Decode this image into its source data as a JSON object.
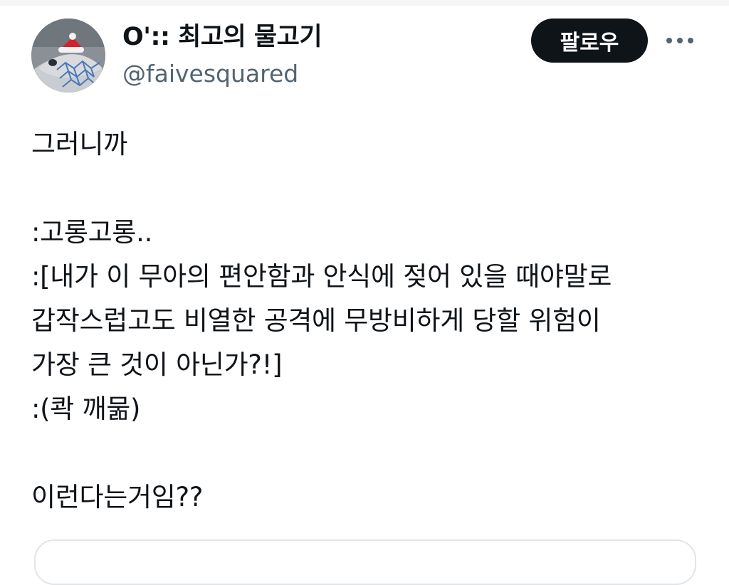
{
  "author": {
    "display_name": "O':: 최고의 물고기",
    "handle": "@faivesquared",
    "avatar_icon": "fish-with-santa-hat-avatar"
  },
  "actions": {
    "follow_label": "팔로우",
    "more_icon": "more-horizontal-icon"
  },
  "tweet": {
    "lines": [
      "그러니까",
      "",
      ":고롱고롱..",
      ":[내가 이 무아의 편안함과 안식에 젖어 있을 때야말로",
      "갑작스럽고도 비열한 공격에 무방비하게 당할 위험이",
      "가장 큰 것이 아닌가?!]",
      ":(콱 깨묾)",
      "",
      "이런다는거임??"
    ]
  },
  "colors": {
    "text_primary": "#0f1419",
    "text_secondary": "#536471",
    "button_bg": "#0f1419",
    "button_text": "#ffffff",
    "border": "#e1e5e8"
  }
}
